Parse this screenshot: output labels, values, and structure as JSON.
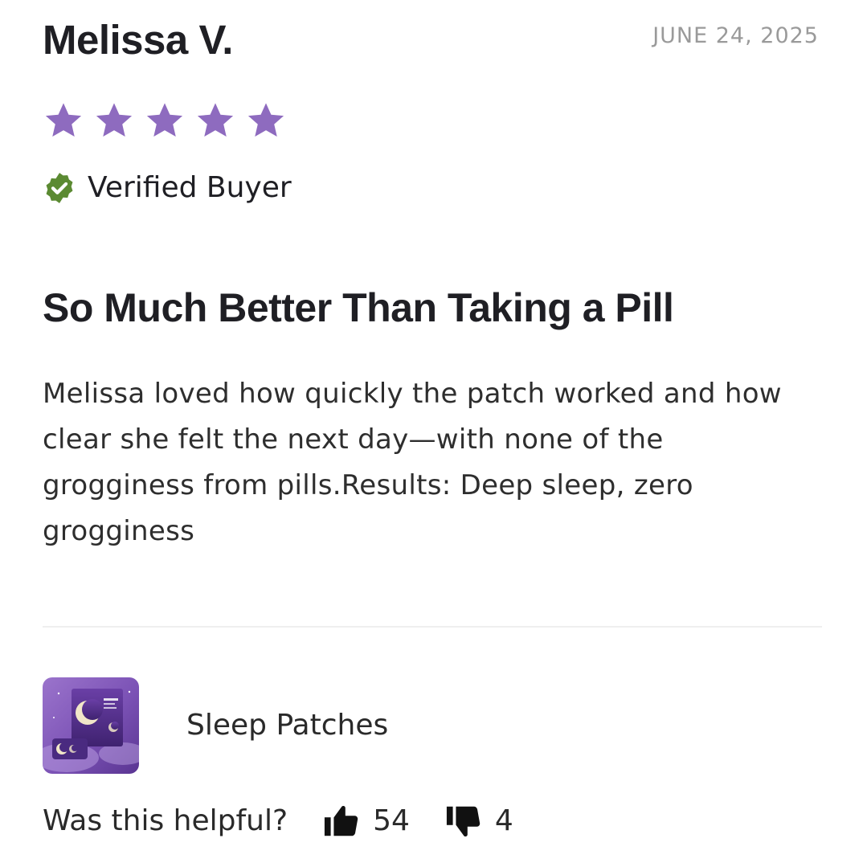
{
  "review": {
    "reviewer_name": "Melissa V.",
    "date": "JUNE 24, 2025",
    "rating": 5,
    "rating_max": 5,
    "star_color": "#8e6bbf",
    "verified_label": "Verified Buyer",
    "verified_color": "#5b8a32",
    "title": "So Much Better Than Taking a Pill",
    "body": "Melissa loved how quickly the patch worked and how clear she felt the next day—with none of the grogginess from pills.Results: Deep sleep, zero grogginess"
  },
  "product": {
    "name": "Sleep Patches",
    "thumbnail_icon": "moon-product-image"
  },
  "helpful": {
    "label": "Was this helpful?",
    "upvotes": "54",
    "downvotes": "4",
    "up_icon": "thumbs-up-icon",
    "down_icon": "thumbs-down-icon"
  }
}
